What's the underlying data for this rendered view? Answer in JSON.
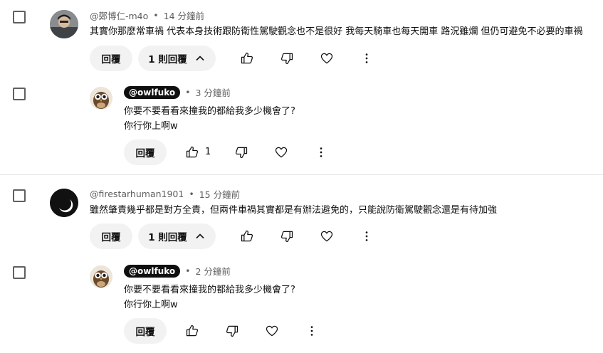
{
  "comments": [
    {
      "author": "@鄭博仁-m4o",
      "time": "14 分鐘前",
      "text": "其實你那麼常車禍 代表本身技術跟防衛性駕駛觀念也不是很好 我每天騎車也每天開車 路況雖爛 但仍可避免不必要的車禍",
      "reply_label": "回覆",
      "replies_label": "1 則回覆",
      "reply": {
        "author": "@owlfuko",
        "time": "3 分鐘前",
        "line1": "你要不要看看來撞我的都給我多少機會了?",
        "line2": "你行你上啊w",
        "reply_label": "回覆",
        "likes": "1"
      }
    },
    {
      "author": "@firestarhuman1901",
      "time": "15 分鐘前",
      "text": "雖然肇責幾乎都是對方全責，但兩件車禍其實都是有辦法避免的，只能說防衛駕駛觀念還是有待加強",
      "reply_label": "回覆",
      "replies_label": "1 則回覆",
      "reply": {
        "author": "@owlfuko",
        "time": "2 分鐘前",
        "line1": "你要不要看看來撞我的都給我多少機會了?",
        "line2": "你行你上啊w",
        "reply_label": "回覆",
        "likes": ""
      }
    }
  ],
  "separator": "•"
}
